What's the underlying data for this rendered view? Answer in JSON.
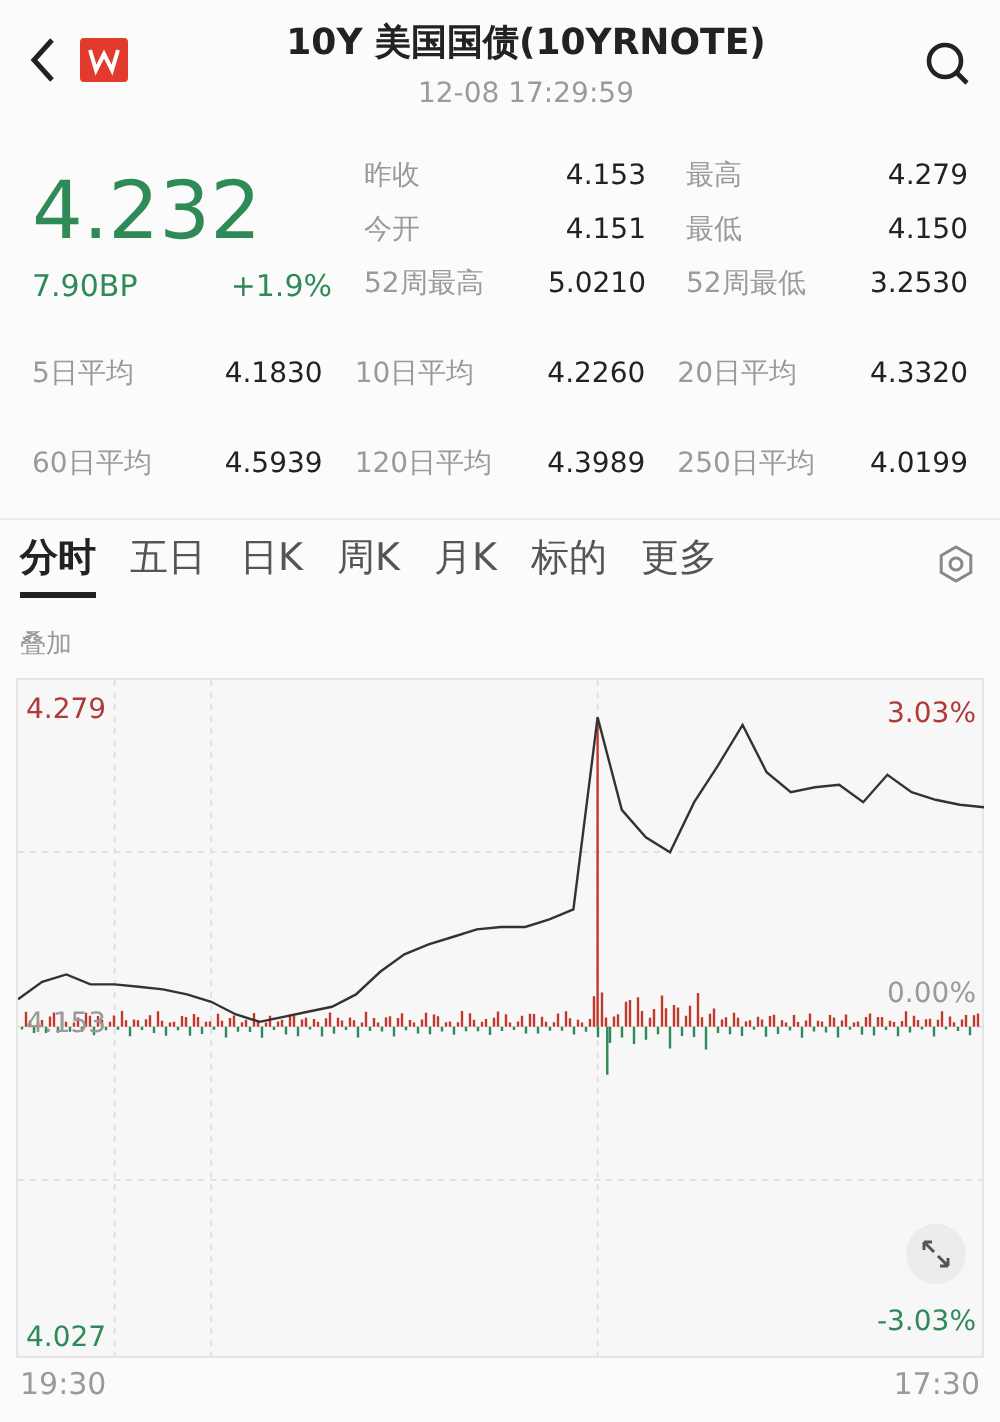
{
  "header": {
    "title": "10Y 美国国债(10YRNOTE)",
    "time": "12-08 17:29:59"
  },
  "quote": {
    "price": "4.232",
    "change_bp": "7.90BP",
    "change_pct": "+1.9%",
    "stats": [
      {
        "label": "昨收",
        "value": "4.153"
      },
      {
        "label": "最高",
        "value": "4.279"
      },
      {
        "label": "今开",
        "value": "4.151"
      },
      {
        "label": "最低",
        "value": "4.150"
      },
      {
        "label": "52周最高",
        "value": "5.0210"
      },
      {
        "label": "52周最低",
        "value": "3.2530"
      }
    ]
  },
  "averages": [
    {
      "label": "5日平均",
      "value": "4.1830"
    },
    {
      "label": "10日平均",
      "value": "4.2260"
    },
    {
      "label": "20日平均",
      "value": "4.3320"
    },
    {
      "label": "60日平均",
      "value": "4.5939"
    },
    {
      "label": "120日平均",
      "value": "4.3989"
    },
    {
      "label": "250日平均",
      "value": "4.0199"
    }
  ],
  "tabs": [
    {
      "label": "分时",
      "selected": true
    },
    {
      "label": "五日",
      "selected": false
    },
    {
      "label": "日K",
      "selected": false
    },
    {
      "label": "周K",
      "selected": false
    },
    {
      "label": "月K",
      "selected": false
    },
    {
      "label": "标的",
      "selected": false
    },
    {
      "label": "更多",
      "selected": false
    }
  ],
  "overlay_label": "叠加",
  "chart": {
    "percent_labels": [
      "3.03%",
      "0.00%",
      "-3.03%"
    ],
    "time_labels": [
      "19:30",
      "17:30"
    ],
    "chart_data": {
      "type": "line",
      "series": [
        {
          "color": "#333333",
          "values": [
            4.164,
            4.171,
            4.174,
            4.17,
            4.17,
            4.169,
            4.168,
            4.166,
            4.163,
            4.158,
            4.155,
            4.157,
            4.159,
            4.161,
            4.166,
            4.175,
            4.182,
            4.186,
            4.189,
            4.192,
            4.193,
            4.193,
            4.196,
            4.2,
            4.277,
            4.24,
            4.229,
            4.223,
            4.243,
            4.258,
            4.274,
            4.255,
            4.247,
            4.249,
            4.25,
            4.243,
            4.254,
            4.247,
            4.244,
            4.242,
            4.241
          ]
        }
      ],
      "ylim": [
        4.021,
        4.292
      ],
      "yticks": [
        {
          "value": 4.279,
          "label": "4.279"
        },
        {
          "value": 4.153,
          "label": "4.153"
        },
        {
          "value": 4.027,
          "label": "4.027"
        }
      ]
    }
  }
}
